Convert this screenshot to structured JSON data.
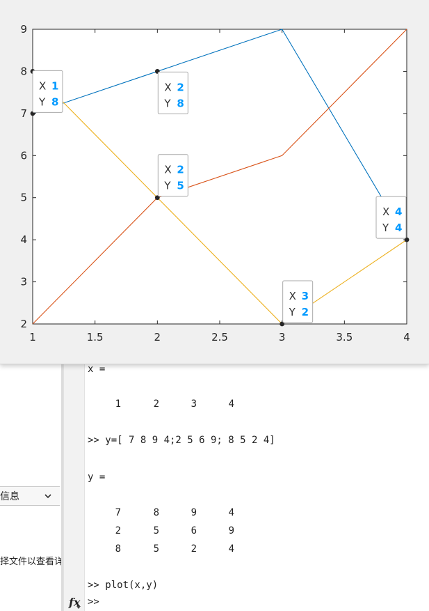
{
  "chart_data": {
    "type": "line",
    "x": [
      1,
      2,
      3,
      4
    ],
    "series": [
      {
        "values": [
          7,
          2,
          8
        ],
        "x": [
          1,
          2,
          3
        ],
        "color": "#0072bd",
        "values_full": [
          7,
          8,
          9,
          4
        ]
      },
      {
        "color": "#d95319",
        "values_full": [
          2,
          5,
          6,
          9
        ]
      },
      {
        "color": "#edb120",
        "values_full": [
          8,
          5,
          2,
          4
        ]
      }
    ],
    "xlim": [
      1,
      4
    ],
    "ylim": [
      2,
      9
    ],
    "xticks": [
      "1",
      "1.5",
      "2",
      "2.5",
      "3",
      "3.5",
      "4"
    ],
    "yticks": [
      "2",
      "3",
      "4",
      "5",
      "6",
      "7",
      "8",
      "9"
    ],
    "grid": false,
    "datatips": [
      {
        "x": "1",
        "y": "8"
      },
      {
        "x": "2",
        "y": "8"
      },
      {
        "x": "2",
        "y": "5"
      },
      {
        "x": "3",
        "y": "2"
      },
      {
        "x": "4",
        "y": "4"
      }
    ],
    "datatip_labels": {
      "x": "X",
      "y": "Y"
    },
    "datatip_value_color": "#0099ff"
  },
  "left_panel": {
    "details_label": "信息",
    "select_hint": "择文件以查看详"
  },
  "command_window": {
    "line1": "x =",
    "x_values": [
      "1",
      "2",
      "3",
      "4"
    ],
    "cmd_y": ">> y=[ 7 8 9 4;2 5 6 9; 8 5 2 4]",
    "line_y": "y =",
    "y_rows": [
      [
        "7",
        "8",
        "9",
        "4"
      ],
      [
        "2",
        "5",
        "6",
        "9"
      ],
      [
        "8",
        "5",
        "2",
        "4"
      ]
    ],
    "cmd_plot": ">> plot(x,y)",
    "prompt": ">>",
    "fx_label": "fx"
  }
}
